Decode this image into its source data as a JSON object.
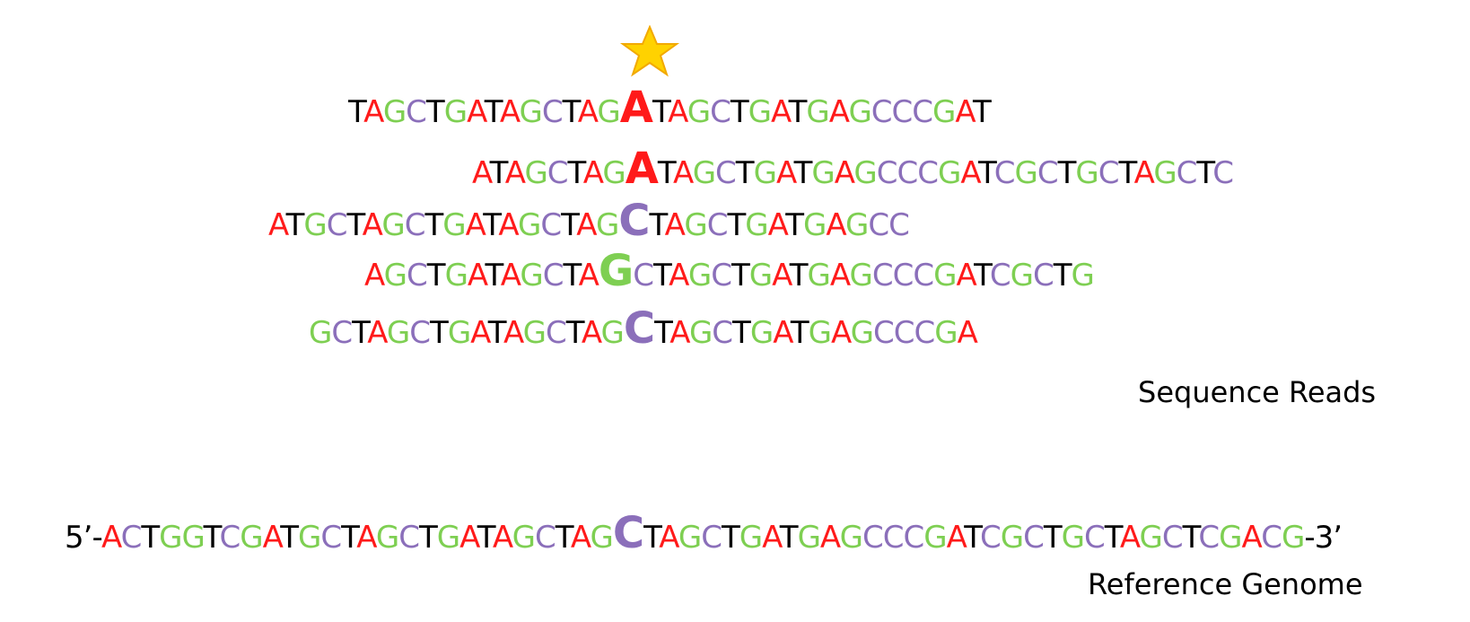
{
  "colors": {
    "A": "#ff1a1a",
    "T": "#000000",
    "G": "#7ecf52",
    "C": "#8b6fba",
    "text": "#000000",
    "star_fill": "#ffd200",
    "star_stroke": "#f2a900"
  },
  "marker_icon": "star-icon",
  "reads": [
    {
      "seq": "TAGCTGATAGCTAGATAGCTGATGAGCCCGAT",
      "variant_index": 14
    },
    {
      "seq": "ATAGCTAGATAGCTGATGAGCCCGATCGCTGCTAGCTC",
      "variant_index": 8
    },
    {
      "seq": "ATGCTAGCTGATAGCTAGCTAGCTGATGAGCC",
      "variant_index": 18
    },
    {
      "seq": "AGCTGATAGCTAGCTAGCTGATGAGCCCGATCGCTG",
      "variant_index": 12
    },
    {
      "seq": "GCTAGCTGATAGCTAGCTAGCTGATGAGCCCGA",
      "variant_index": 16
    }
  ],
  "reads_label": "Sequence Reads",
  "reference": {
    "prefix": "5’-",
    "seq": "ACTGGTCGATGCTAGCTGATAGCTAGCTAGCTGATGAGCCCGATCGCTGCTAGCTCGACG",
    "suffix": "-3’",
    "variant_index": 26
  },
  "reference_label": "Reference Genome"
}
